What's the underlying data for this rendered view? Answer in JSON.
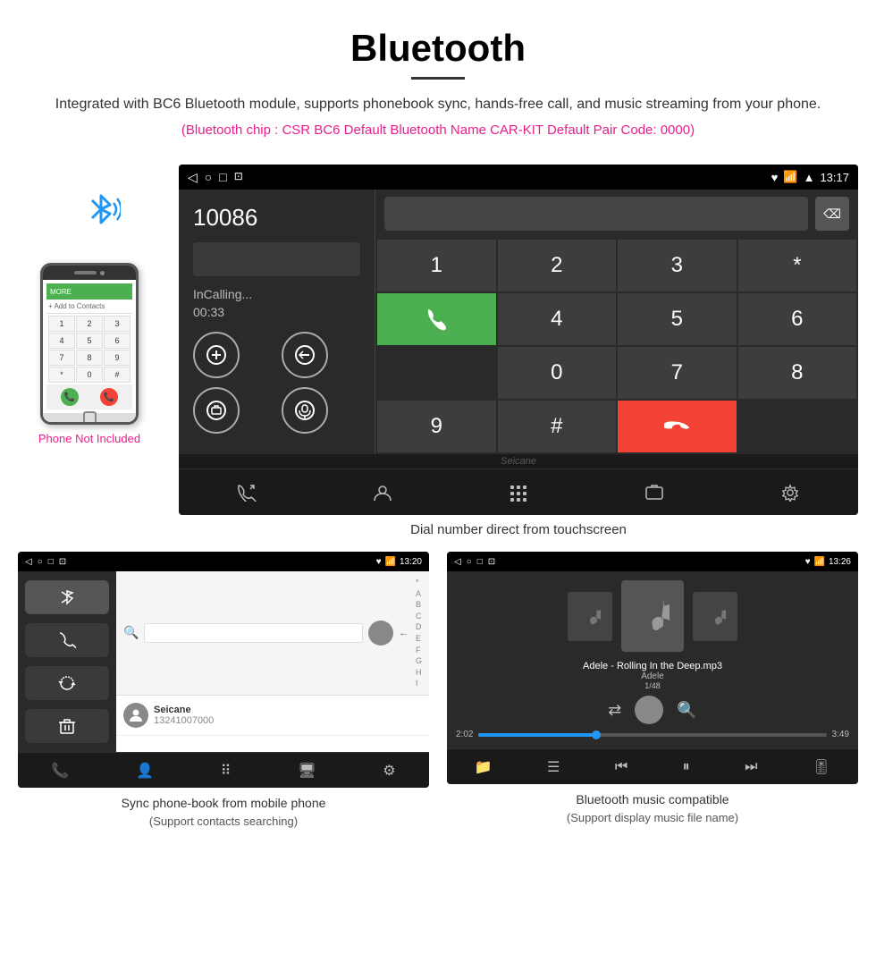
{
  "header": {
    "title": "Bluetooth",
    "description": "Integrated with BC6 Bluetooth module, supports phonebook sync, hands-free call, and music streaming from your phone.",
    "specs": "(Bluetooth chip : CSR BC6    Default Bluetooth Name CAR-KIT    Default Pair Code: 0000)"
  },
  "phone": {
    "not_included": "Phone Not Included",
    "keys": [
      "1",
      "2",
      "3",
      "4",
      "5",
      "6",
      "7",
      "8",
      "9",
      "*",
      "0",
      "#"
    ]
  },
  "car_screen": {
    "status_time": "13:17",
    "call_number": "10086",
    "call_status": "InCalling...",
    "call_timer": "00:33",
    "dialpad_keys": [
      "1",
      "2",
      "3",
      "*",
      "4",
      "5",
      "6",
      "0",
      "7",
      "8",
      "9",
      "#"
    ],
    "caption": "Dial number direct from touchscreen"
  },
  "phonebook_screen": {
    "status_time": "13:20",
    "contact_name": "Seicane",
    "contact_number": "13241007000",
    "alpha_list": "A\nB\nC\nD\nE\nF\nG\nH\nI",
    "caption": "Sync phone-book from mobile phone",
    "caption_sub": "(Support contacts searching)"
  },
  "music_screen": {
    "status_time": "13:26",
    "song_title": "Adele - Rolling In the Deep.mp3",
    "artist": "Adele",
    "track_info": "1/48",
    "time_current": "2:02",
    "time_total": "3:49",
    "progress_percent": 35,
    "caption": "Bluetooth music compatible",
    "caption_sub": "(Support display music file name)"
  }
}
